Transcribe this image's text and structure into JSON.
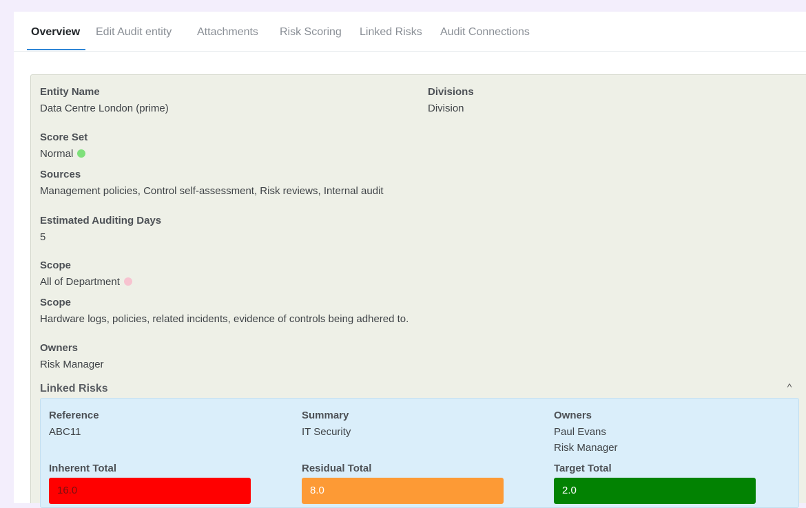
{
  "tabs": [
    {
      "label": "Overview",
      "active": true
    },
    {
      "label": "Edit Audit entity"
    },
    {
      "label": "Attachments"
    },
    {
      "label": "Risk Scoring"
    },
    {
      "label": "Linked Risks"
    },
    {
      "label": "Audit Connections"
    }
  ],
  "entity": {
    "name_label": "Entity Name",
    "name_value": "Data Centre London (prime)",
    "divisions_label": "Divisions",
    "divisions_value": "Division",
    "score_set_label": "Score Set",
    "score_set_value": "Normal",
    "score_set_color": "#7ee07a",
    "sources_label": "Sources",
    "sources_value": "Management policies, Control self-assessment, Risk reviews, Internal audit",
    "days_label": "Estimated Auditing Days",
    "days_value": "5",
    "scope_label": "Scope",
    "scope_value": "All of Department",
    "scope_color": "#f7c3d0",
    "scope2_label": "Scope",
    "scope2_value": "Hardware logs, policies, related incidents, evidence of controls being adhered to.",
    "owners_label": "Owners",
    "owners_value": "Risk Manager"
  },
  "linked_risks": {
    "title": "Linked Risks",
    "collapse_icon": "chevron-up-icon",
    "collapse_glyph": "^",
    "reference_label": "Reference",
    "reference_value": "ABC11",
    "summary_label": "Summary",
    "summary_value": "IT Security",
    "owners_label": "Owners",
    "owners_values": [
      "Paul Evans",
      "Risk Manager"
    ],
    "inherent_label": "Inherent Total",
    "inherent_value": "16.0",
    "inherent_color": "#ff0000",
    "residual_label": "Residual Total",
    "residual_value": "8.0",
    "residual_color": "#fd9a35",
    "target_label": "Target Total",
    "target_value": "2.0",
    "target_color": "#028202"
  }
}
